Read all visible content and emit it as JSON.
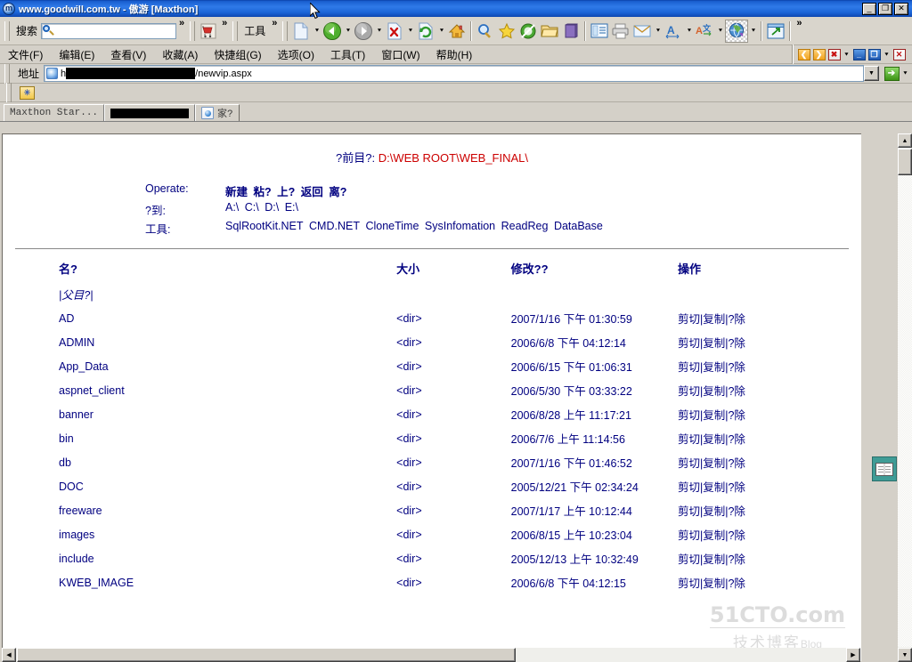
{
  "window": {
    "title": "www.goodwill.com.tw - 傲游 [Maxthon]",
    "app_icon": "maxthon-logo-icon",
    "minimize": "_",
    "maximize": "❐",
    "close": "✕"
  },
  "toolbar": {
    "search_label": "搜索",
    "search_value": "",
    "search_placeholder": "",
    "tools_label": "工具",
    "chevron": "»",
    "icons": [
      {
        "name": "cart-icon",
        "glyph": "🛒"
      },
      {
        "name": "new-page-icon",
        "glyph": "page"
      },
      {
        "name": "back-icon",
        "glyph": "◀"
      },
      {
        "name": "forward-icon",
        "glyph": "▶"
      },
      {
        "name": "stop-icon",
        "glyph": "✖"
      },
      {
        "name": "refresh-icon",
        "glyph": "↻"
      },
      {
        "name": "home-icon",
        "glyph": "⌂"
      },
      {
        "name": "find-icon",
        "glyph": "🔍"
      },
      {
        "name": "favorites-star-icon",
        "glyph": "★"
      },
      {
        "name": "ad-hunter-icon",
        "glyph": "◎"
      },
      {
        "name": "open-folder-icon",
        "glyph": "📂"
      },
      {
        "name": "history-book-icon",
        "glyph": "📕"
      },
      {
        "name": "notes-icon",
        "glyph": "▤"
      },
      {
        "name": "print-icon",
        "glyph": "🖶"
      },
      {
        "name": "mail-icon",
        "glyph": "✉"
      },
      {
        "name": "font-size-icon",
        "glyph": "A"
      },
      {
        "name": "translate-icon",
        "glyph": "A文"
      },
      {
        "name": "globe-plugin-icon",
        "glyph": "🌐"
      },
      {
        "name": "external-window-icon",
        "glyph": "⇱"
      }
    ]
  },
  "menubar": {
    "items": [
      {
        "label": "文件(F)",
        "name": "menu-file"
      },
      {
        "label": "编辑(E)",
        "name": "menu-edit"
      },
      {
        "label": "查看(V)",
        "name": "menu-view"
      },
      {
        "label": "收藏(A)",
        "name": "menu-favorites"
      },
      {
        "label": "快捷组(G)",
        "name": "menu-group"
      },
      {
        "label": "选项(O)",
        "name": "menu-options"
      },
      {
        "label": "工具(T)",
        "name": "menu-tools"
      },
      {
        "label": "窗口(W)",
        "name": "menu-window"
      },
      {
        "label": "帮助(H)",
        "name": "menu-help"
      }
    ],
    "right_buttons": [
      {
        "name": "tab-prev-button",
        "glyph": "❮"
      },
      {
        "name": "tab-next-button",
        "glyph": "❯"
      },
      {
        "name": "tab-close-button",
        "glyph": "✖"
      },
      {
        "name": "tab-close-dropdown",
        "glyph": "▼"
      },
      {
        "name": "window-minimize-mdi-button",
        "glyph": "_"
      },
      {
        "name": "window-restore-mdi-button",
        "glyph": "❐"
      },
      {
        "name": "window-restore-dropdown",
        "glyph": "▼"
      },
      {
        "name": "window-close-mdi-button",
        "glyph": "✕"
      }
    ]
  },
  "address_bar": {
    "label": "地址",
    "prefix": "h",
    "redacted": true,
    "suffix": "/newvip.aspx",
    "dropdown_glyph": "▼",
    "go_glyph": "➔",
    "go_dropdown_glyph": "▼"
  },
  "links_bar": {
    "folder_icon": "new-folder-icon",
    "folder_glyph": "✳"
  },
  "tabs": [
    {
      "label": "Maxthon Star...",
      "name": "tab-maxthon-start",
      "redacted": false,
      "active": false
    },
    {
      "label": "",
      "name": "tab-redacted",
      "redacted": true,
      "active": false
    },
    {
      "label": "家?",
      "name": "tab-current-page",
      "redacted": false,
      "active": true,
      "icon": "page-icon"
    }
  ],
  "page": {
    "current_dir_label": "?前目?:",
    "current_dir_value": "D:\\WEB ROOT\\WEB_FINAL\\",
    "operate_label": "Operate:",
    "operate_items": [
      "新建",
      "粘?",
      "上?",
      "返回",
      "离?"
    ],
    "goto_label": "?到:",
    "goto_items": [
      "A:\\",
      "C:\\",
      "D:\\",
      "E:\\"
    ],
    "tools_label": "工具:",
    "tools_items": [
      "SqlRootKit.NET",
      "CMD.NET",
      "CloneTime",
      "SysInfomation",
      "ReadReg",
      "DataBase"
    ],
    "columns": [
      "名?",
      "大小",
      "修改??",
      "操作"
    ],
    "parent_link": "|父目?|",
    "rows": [
      {
        "name": "AD",
        "size": "<dir>",
        "modified": "2007/1/16 下午 01:30:59",
        "actions": "剪切|复制|?除"
      },
      {
        "name": "ADMIN",
        "size": "<dir>",
        "modified": "2006/6/8 下午  04:12:14",
        "actions": "剪切|复制|?除"
      },
      {
        "name": "App_Data",
        "size": "<dir>",
        "modified": "2006/6/15 下午 01:06:31",
        "actions": "剪切|复制|?除"
      },
      {
        "name": "aspnet_client",
        "size": "<dir>",
        "modified": "2006/5/30 下午 03:33:22",
        "actions": "剪切|复制|?除"
      },
      {
        "name": "banner",
        "size": "<dir>",
        "modified": "2006/8/28 上午 11:17:21",
        "actions": "剪切|复制|?除"
      },
      {
        "name": "bin",
        "size": "<dir>",
        "modified": "2006/7/6 上午  11:14:56",
        "actions": "剪切|复制|?除"
      },
      {
        "name": "db",
        "size": "<dir>",
        "modified": "2007/1/16 下午 01:46:52",
        "actions": "剪切|复制|?除"
      },
      {
        "name": "DOC",
        "size": "<dir>",
        "modified": "2005/12/21 下午 02:34:24",
        "actions": "剪切|复制|?除"
      },
      {
        "name": "freeware",
        "size": "<dir>",
        "modified": "2007/1/17 上午 10:12:44",
        "actions": "剪切|复制|?除"
      },
      {
        "name": "images",
        "size": "<dir>",
        "modified": "2006/8/15 上午 10:23:04",
        "actions": "剪切|复制|?除"
      },
      {
        "name": "include",
        "size": "<dir>",
        "modified": "2005/12/13 上午 10:32:49",
        "actions": "剪切|复制|?除"
      },
      {
        "name": "KWEB_IMAGE",
        "size": "<dir>",
        "modified": "2006/6/8 下午  04:12:15",
        "actions": "剪切|复制|?除"
      }
    ]
  },
  "sidebar_toggle": {
    "name": "reader-book-button",
    "glyph": "book"
  },
  "watermark": {
    "line1": "51CTO.com",
    "line2": "技术博客",
    "line3": "Blog"
  },
  "scrollbars": {
    "up_glyph": "▲",
    "down_glyph": "▼",
    "left_glyph": "◀",
    "right_glyph": "▶"
  },
  "colors": {
    "title_blue": "#1b64d6",
    "chrome_gray": "#d4d0c8",
    "link_navy": "#000080",
    "path_red": "#cc0000"
  }
}
